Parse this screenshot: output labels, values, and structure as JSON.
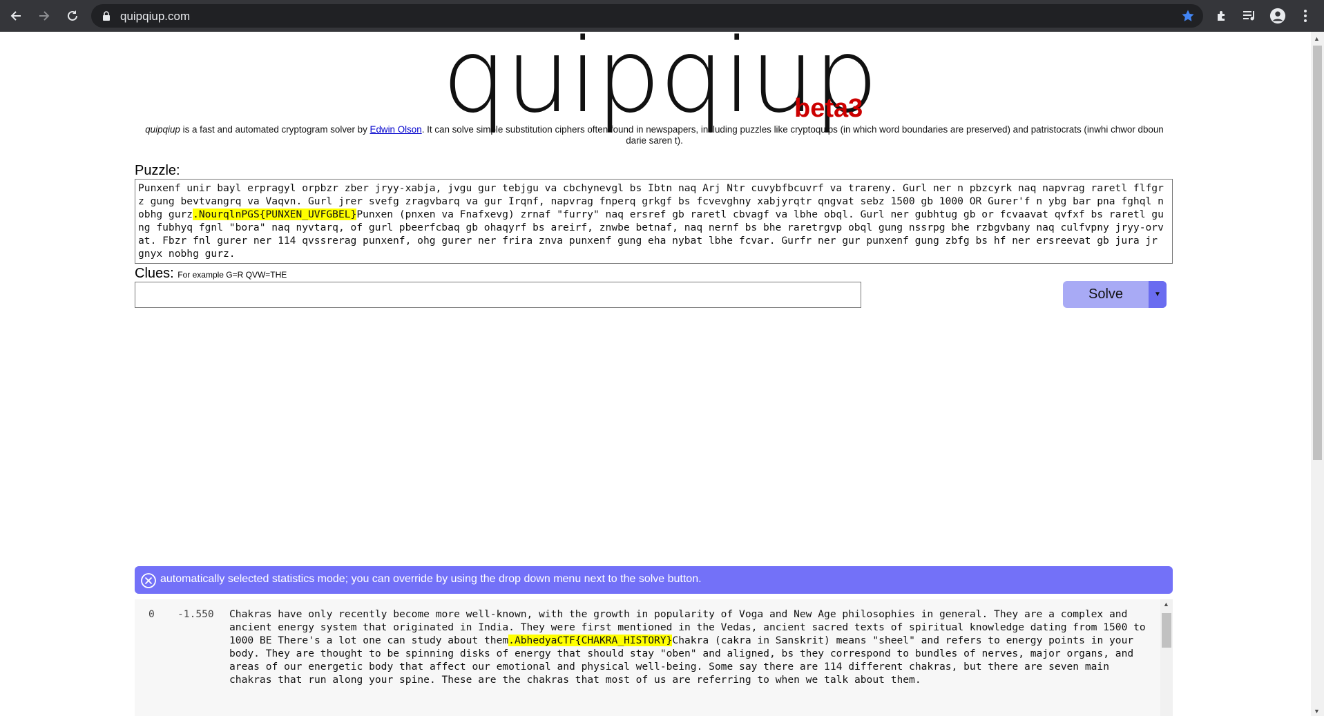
{
  "browser": {
    "url": "quipqiup.com",
    "icons": [
      "back-arrow-icon",
      "forward-arrow-icon",
      "reload-icon",
      "lock-icon",
      "star-icon",
      "extensions-icon",
      "media-icon",
      "profile-icon",
      "menu-icon"
    ]
  },
  "header": {
    "logo": "quipqiup",
    "beta": "beta3",
    "intro_brand": "quipqiup",
    "intro_part1": " is a fast and automated cryptogram solver by ",
    "intro_link": "Edwin Olson",
    "intro_part2": ". It can solve simple substitution ciphers often found in newspapers, including puzzles like cryptoquips (in which word boundaries are preserved) and patristocrats (inwhi chwor dboun darie saren t)."
  },
  "puzzle": {
    "label": "Puzzle:",
    "text_before": "Punxenf unir bayl erpragyl orpbzr zber jryy-xabja, jvgu gur tebjgu va cbchynevgl bs Ibtn naq Arj Ntr cuvybfbcuvrf va trareny. Gurl ner n pbzcyrk naq napvrag raretl flfgrz gung bevtvangrq va Vaqvn. Gurl jrer svefg zragvbarq va gur Irqnf, napvrag fnperq grkgf bs fcvevghny xabjyrqtr qngvat sebz 1500 gb 1000 OR Gurer'f n ybg bar pna fghql nobhg gurz",
    "flag": ".NourqlnPGS{PUNXEN_UVFGBEL}",
    "text_after": "Punxen (pnxen va Fnafxevg) zrnaf \"furry\" naq ersref gb raretl cbvagf va lbhe obql. Gurl ner gubhtug gb or fcvaavat qvfxf bs raretl gung fubhyq fgnl \"bora\" naq nyvtarq, of gurl pbeerfcbaq gb ohaqyrf bs areirf, znwbe betnaf, naq nernf bs bhe raretrgvp obql gung nssrpg bhe rzbgvbany naq culfvpny jryy-orvat. Fbzr fnl gurer ner 114 qvssrerag punxenf, ohg gurer ner frira znva punxenf gung eha nybat lbhe fcvar. Gurfr ner gur punxenf gung zbfg bs hf ner ersreevat gb jura jr gnyx nobhg gurz."
  },
  "clues": {
    "label": "Clues:",
    "example": "For example G=R QVW=THE",
    "value": ""
  },
  "solve": {
    "label": "Solve",
    "dropdown": "▼"
  },
  "alert": {
    "message": "automatically selected statistics mode; you can override by using the drop down menu next to the solve button."
  },
  "results": [
    {
      "index": "0",
      "score": "-1.550",
      "text_before": "Chakras have only recently become more well-known, with the growth in popularity of Voga and New Age philosophies in general. They are a complex and ancient energy system that originated in India. They were first mentioned in the Vedas, ancient sacred texts of spiritual knowledge dating from 1500 to 1000 BE There's a lot one can study about them",
      "flag": ".AbhedyaCTF{CHAKRA_HISTORY}",
      "text_after": "Chakra (cakra in Sanskrit) means \"sheel\" and refers to energy points in your body. They are thought to be spinning disks of energy that should stay \"oben\" and aligned, bs they correspond to bundles of nerves, major organs, and areas of our energetic body that affect our emotional and physical well-being. Some say there are 114 different chakras, but there are seven main chakras that run along your spine. These are the chakras that most of us are referring to when we talk about them."
    }
  ],
  "colors": {
    "chrome_bg": "#35363a",
    "omnibox_bg": "#202124",
    "beta_red": "#cc0000",
    "alert_bg": "#7371f8",
    "solve_bg": "#a8aaf5",
    "highlight": "#ffff00"
  }
}
